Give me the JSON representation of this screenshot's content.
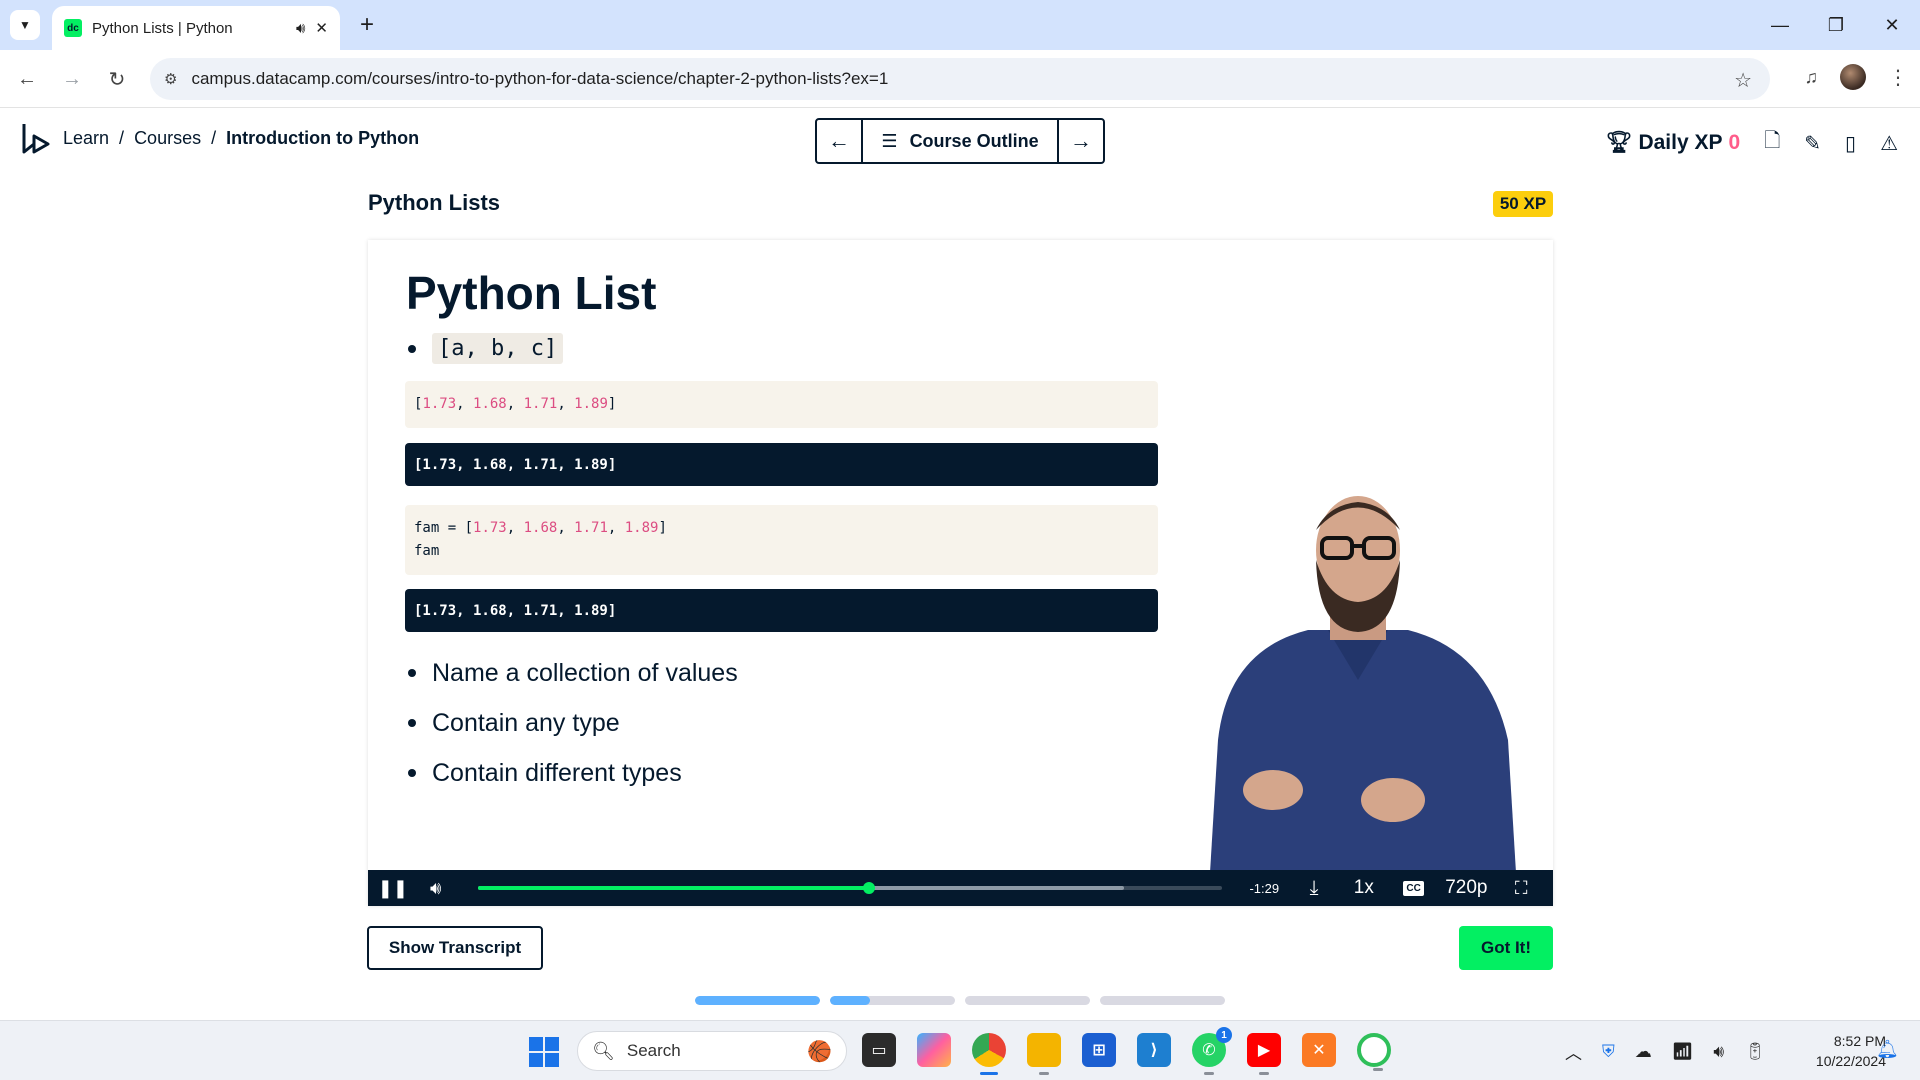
{
  "browser": {
    "tab_title": "Python Lists | Python",
    "url": "campus.datacamp.com/courses/intro-to-python-for-data-science/chapter-2-python-lists?ex=1"
  },
  "header": {
    "breadcrumb": [
      "Learn",
      "Courses",
      "Introduction to Python"
    ],
    "course_outline_label": "Course Outline",
    "daily_xp_label": "Daily XP",
    "daily_xp_value": "0"
  },
  "exercise": {
    "title": "Python Lists",
    "xp_badge": "50 XP"
  },
  "slide": {
    "heading": "Python List",
    "inline_code": "[a, b, c]",
    "code1_numbers": [
      "1.73",
      "1.68",
      "1.71",
      "1.89"
    ],
    "output1": "[1.73, 1.68, 1.71, 1.89]",
    "code2_prefix": "fam = ",
    "code2_numbers": [
      "1.73",
      "1.68",
      "1.71",
      "1.89"
    ],
    "code2_line2": "fam",
    "output2": "[1.73, 1.68, 1.71, 1.89]",
    "bullets": [
      "Name a collection of values",
      "Contain any type",
      "Contain different types"
    ]
  },
  "player": {
    "time_remaining": "-1:29",
    "playback_rate": "1x",
    "quality": "720p",
    "progress_played": 0.525,
    "progress_buffered": 0.868
  },
  "actions": {
    "show_transcript": "Show Transcript",
    "got_it": "Got It!"
  },
  "steps": [
    1.0,
    0.32,
    0,
    0
  ],
  "taskbar": {
    "search_label": "Search",
    "time": "8:52 PM",
    "date": "10/22/2024",
    "whatsapp_badge": "1"
  },
  "colors": {
    "brand_green": "#03ef62",
    "navy": "#05192d",
    "xp_yellow": "#fcce0d",
    "code_number": "#dc4d82",
    "step_blue": "#5eb1ff"
  }
}
